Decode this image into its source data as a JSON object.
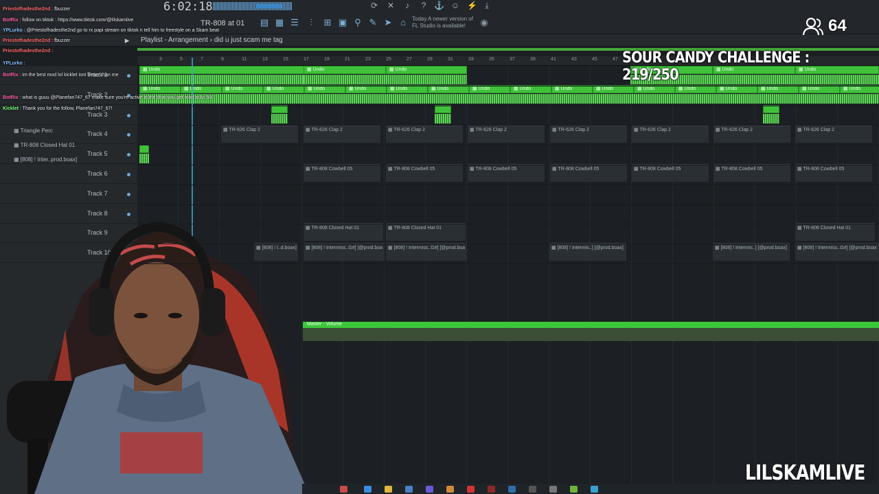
{
  "toolbar": {
    "clock": "6:02:18",
    "pattern": "TR-808 at 01",
    "news": "Today  A newer version of FL Studio is available!"
  },
  "playlist": {
    "title": "Playlist - Arrangement  ›  did u just scam me tag"
  },
  "timeline": {
    "ticks": [
      "3",
      "5",
      "7",
      "9",
      "11",
      "13",
      "15",
      "17",
      "19",
      "21",
      "23",
      "25",
      "27",
      "29",
      "31",
      "33",
      "35",
      "37",
      "39",
      "41",
      "43",
      "45",
      "47"
    ]
  },
  "tracks": [
    {
      "label": "Track 1"
    },
    {
      "label": "Track 2"
    },
    {
      "label": "Track 3"
    },
    {
      "label": "Track 4"
    },
    {
      "label": "Track 5"
    },
    {
      "label": "Track 6"
    },
    {
      "label": "Track 7"
    },
    {
      "label": "Track 8"
    },
    {
      "label": "Track 9"
    },
    {
      "label": "Track 10"
    }
  ],
  "channels": [
    {
      "label": "Triangle Perc"
    },
    {
      "label": "TR-808 Closed Hat 01"
    },
    {
      "label": "[808] ! Inter..prod.boax]"
    }
  ],
  "clips": {
    "undo": "Undo",
    "clap": "TR-626 Clap 2",
    "cowbell": "TR-808 Cowbell 05",
    "closed_hat": "TR-808 Closed Hat 01",
    "intermiss_a": "[808] ! I..d.boax]",
    "intermiss_b": "[808] ! Intermiss..G#] [@prod.boax]",
    "intermiss_c": "[808] ! Intermis..] [@prod.boax]",
    "master": "Master - Volume"
  },
  "chat": [
    {
      "user": "Priestofhadesthe2nd",
      "text": ": fbuzzer",
      "color": "#ff6a6a"
    },
    {
      "user": "BotRix",
      "text": ": follow on tiktok : https://www.tiktok.com/@lilskamlive",
      "color": "#ff5fa8"
    },
    {
      "user": "YPLurko",
      "text": ": @Priestofhadesthe2nd go to rx papi stream on tiktok n tell him to freestyle on a Skam beat",
      "color": "#7fc0ff"
    },
    {
      "user": "Priestofhadesthe2nd",
      "text": ": fbuzzer",
      "color": "#ff6a6a"
    },
    {
      "user": "Priestofhadesthe2nd",
      "text": ":",
      "color": "#ff6a6a"
    },
    {
      "user": "YPLurko",
      "text": ":",
      "color": "#7fc0ff"
    },
    {
      "user": "BotRix",
      "text": ": im the best mod lol kicklet isnt better than me",
      "color": "#ff5fa8"
    },
    {
      "user": "BotRix",
      "text": ": what is guuu @Planefan747_67 make sure you're active in the chat you get mod at lvl 50",
      "color": "#ff5fa8"
    },
    {
      "user": "Kicklet",
      "text": ": Thank you for the follow, Planefan747_67!",
      "color": "#7bff7b"
    }
  ],
  "overlay": {
    "viewers": "64",
    "challenge": "SOUR CANDY CHALLENGE : 219/250",
    "channel": "LILSKAMLIVE"
  },
  "colors": {
    "clip_green": "#3fc23a",
    "accent_blue": "#3aa9c8"
  }
}
